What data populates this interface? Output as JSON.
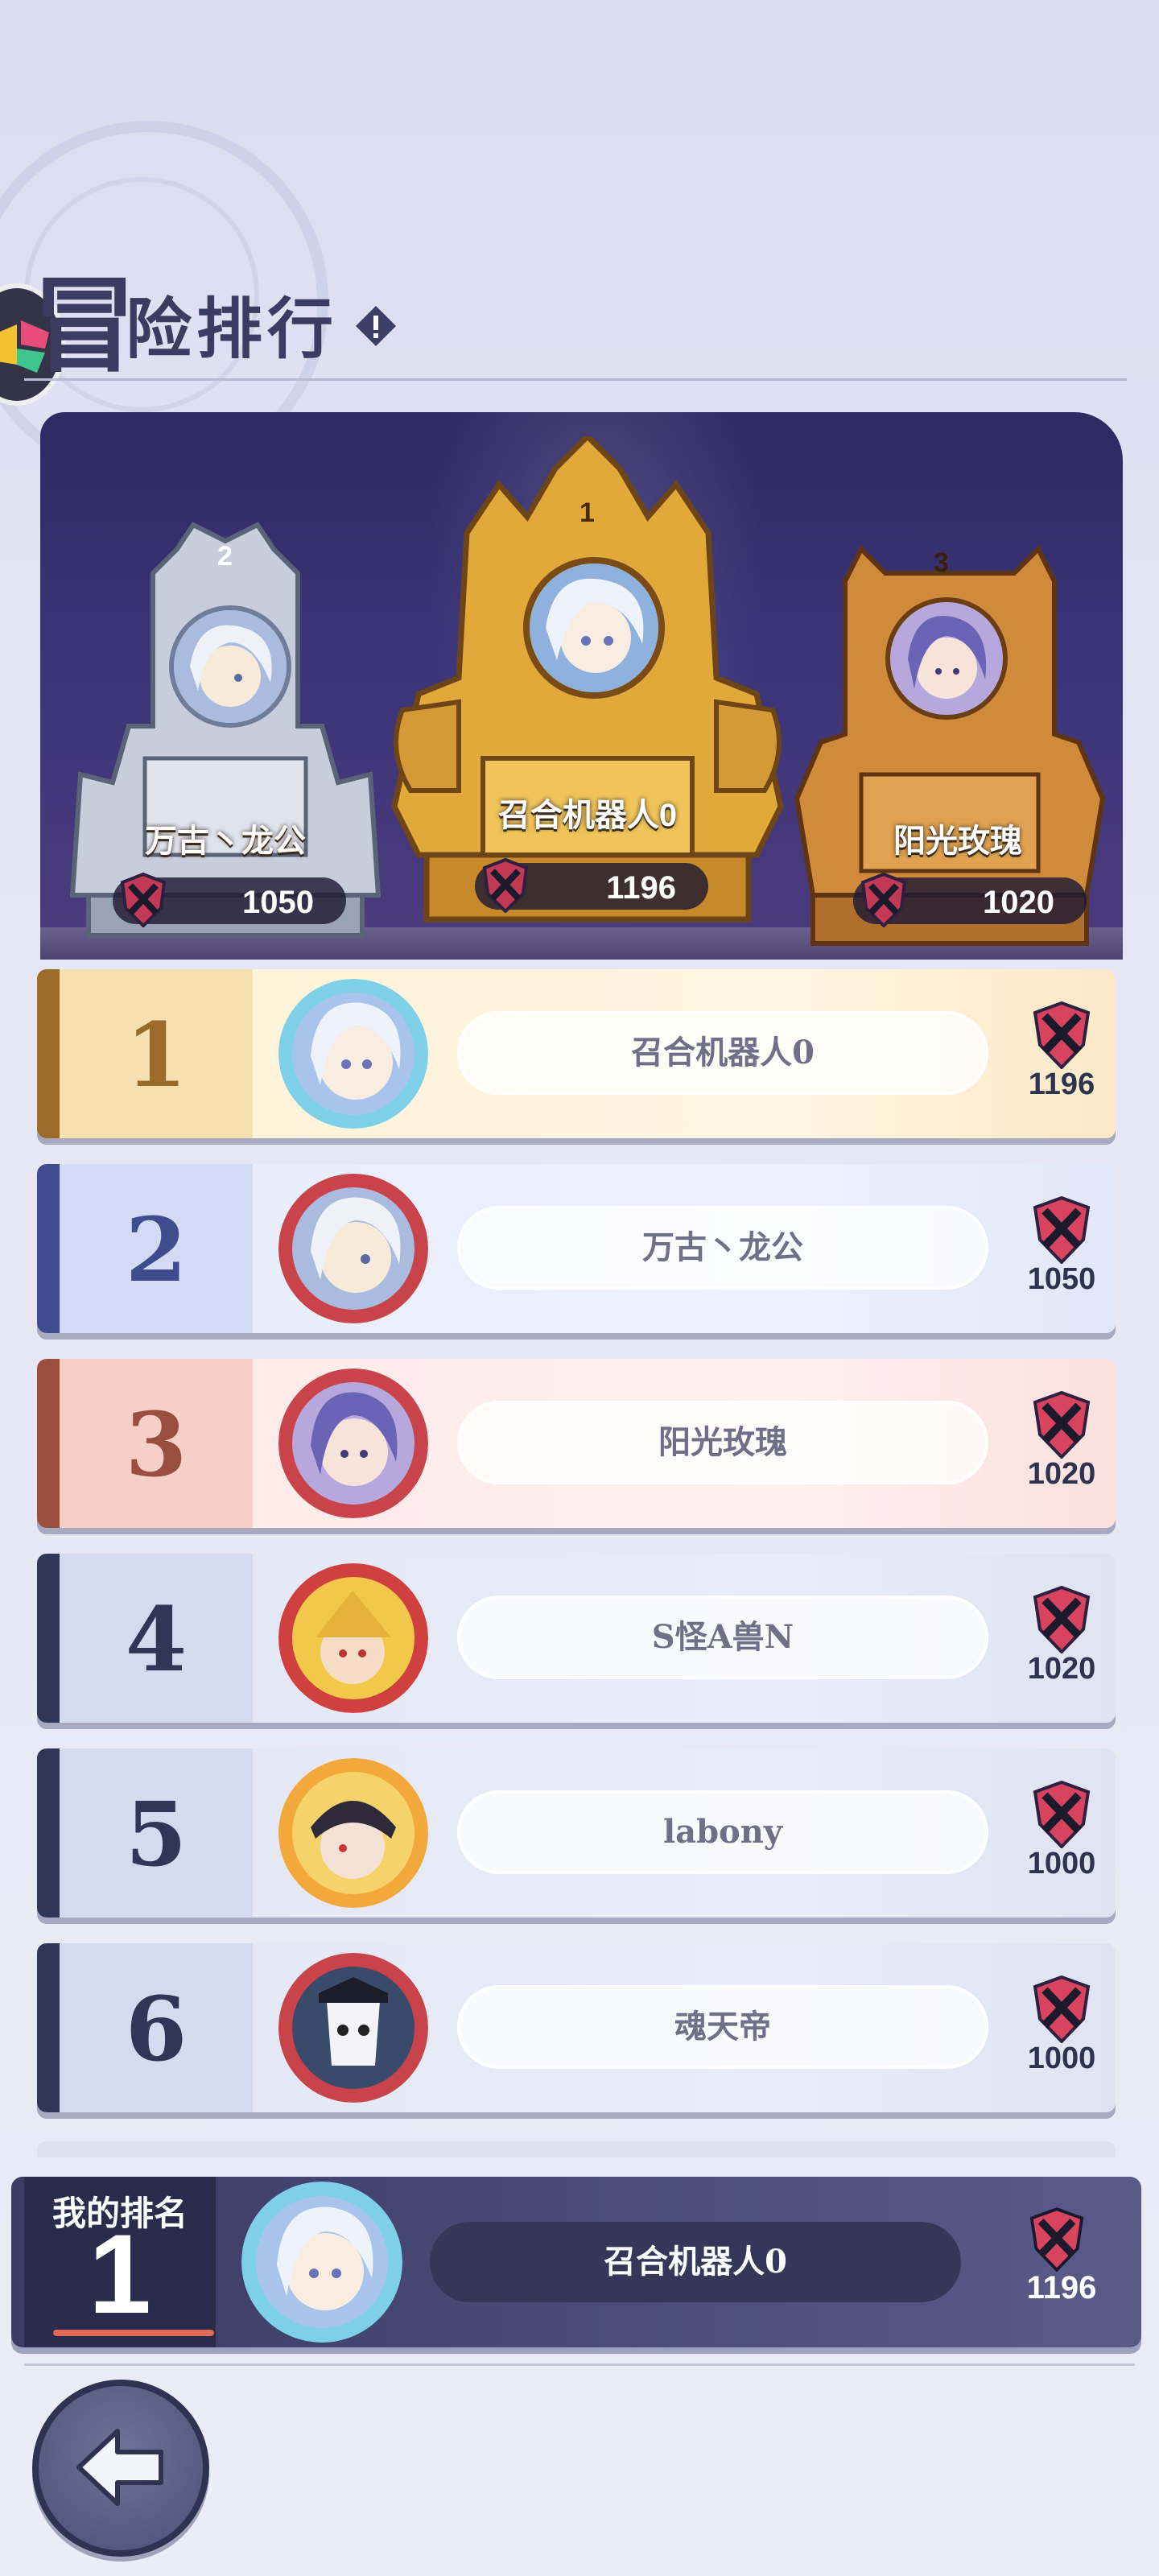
{
  "header": {
    "title_first_char": "冒",
    "title_rest": "险排行"
  },
  "podium": [
    {
      "rank": "2",
      "name": "万古丶龙公",
      "score": "1050"
    },
    {
      "rank": "1",
      "name": "召合机器人0",
      "score": "1196"
    },
    {
      "rank": "3",
      "name": "阳光玫瑰",
      "score": "1020"
    }
  ],
  "rankings": [
    {
      "rank": "1",
      "name": "召合机器人0",
      "score": "1196"
    },
    {
      "rank": "2",
      "name": "万古丶龙公",
      "score": "1050"
    },
    {
      "rank": "3",
      "name": "阳光玫瑰",
      "score": "1020"
    },
    {
      "rank": "4",
      "name": "S怪A兽N",
      "score": "1020"
    },
    {
      "rank": "5",
      "name": "labony",
      "score": "1000"
    },
    {
      "rank": "6",
      "name": "魂天帝",
      "score": "1000"
    }
  ],
  "my_rank": {
    "label": "我的排名",
    "rank": "1",
    "name": "召合机器人0",
    "score": "1196"
  },
  "colors": {
    "gold": "#9a6b2a",
    "silver": "#3f4d8e",
    "bronze": "#9a4f3e",
    "navy": "#2f3656",
    "accent": "#e06a55"
  },
  "icons": {
    "score": "crossed-swords-shield-icon",
    "back": "back-arrow-icon",
    "info": "info-icon"
  }
}
